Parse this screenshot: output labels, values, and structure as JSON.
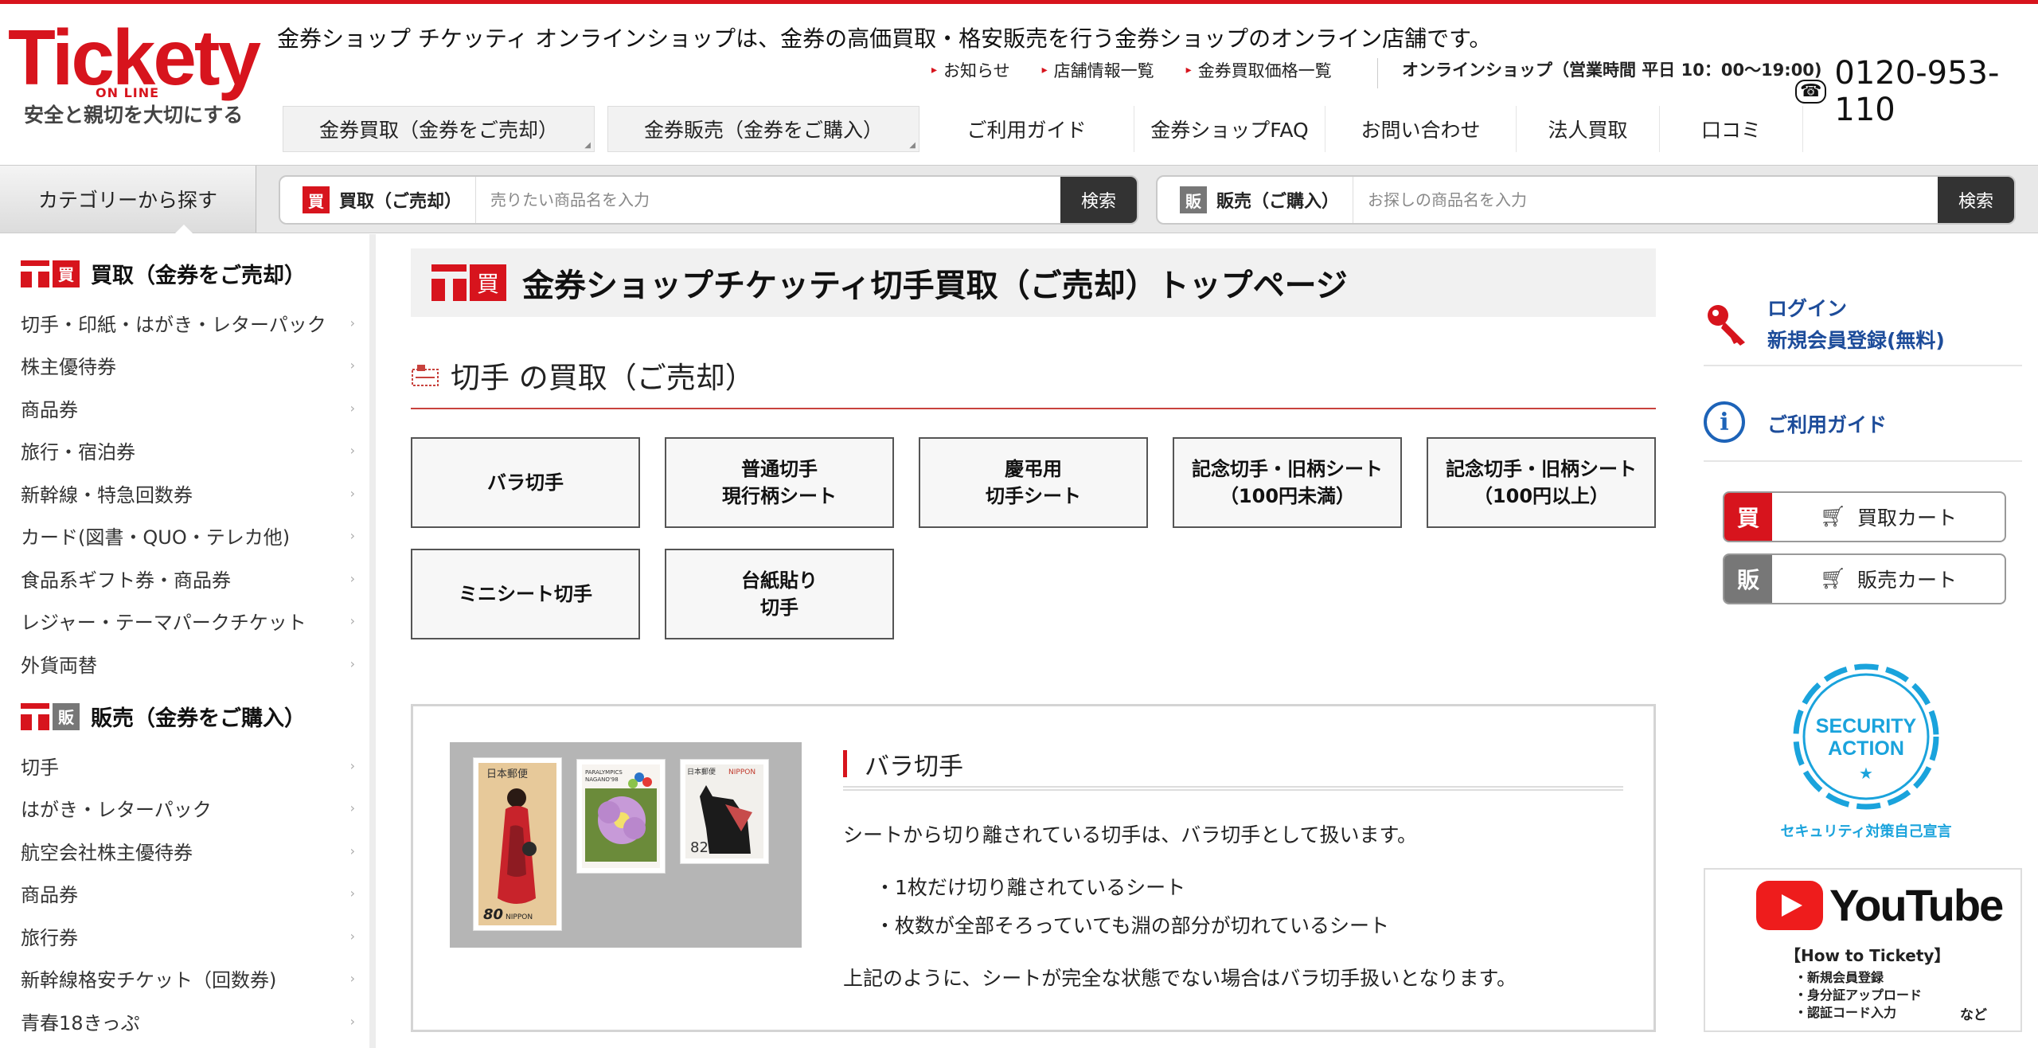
{
  "header": {
    "logo_text": "Tickety",
    "logo_sub": "ON LINE",
    "logo_tagline": "安全と親切を大切にする",
    "tagline": "金券ショップ チケッティ オンラインショップは、金券の高価買取・格安販売を行う金券ショップのオンライン店舗です。",
    "top_links": [
      "お知らせ",
      "店舗情報一覧",
      "金券買取価格一覧"
    ],
    "hours": "オンラインショップ（営業時間 平日 10：00〜19:00)",
    "phone_icon": "free-dial-icon",
    "phone": "0120-953-110",
    "nav_buttons": [
      "金券買取（金券をご売却）",
      "金券販売（金券をご購入）"
    ],
    "nav_links": [
      "ご利用ガイド",
      "金券ショップFAQ",
      "お問い合わせ",
      "法人買取",
      "口コミ"
    ]
  },
  "search": {
    "category_button": "カテゴリーから探す",
    "buy_badge": "買",
    "buy_label": "買取（ご売却）",
    "buy_placeholder": "売りたい商品名を入力",
    "buy_button": "検索",
    "sell_badge": "販",
    "sell_label": "販売（ご購入）",
    "sell_placeholder": "お探しの商品名を入力",
    "sell_button": "検索"
  },
  "sidebar": {
    "buy_head_badge": "買",
    "buy_head": "買取（金券をご売却）",
    "buy_items": [
      "切手・印紙・はがき・レターパック",
      "株主優待券",
      "商品券",
      "旅行・宿泊券",
      "新幹線・特急回数券",
      "カード(図書・QUO・テレカ他)",
      "食品系ギフト券・商品券",
      "レジャー・テーマパークチケット",
      "外貨両替"
    ],
    "sell_head_badge": "販",
    "sell_head": "販売（金券をご購入）",
    "sell_items": [
      "切手",
      "はがき・レターパック",
      "航空会社株主優待券",
      "商品券",
      "旅行券",
      "新幹線格安チケット（回数券)",
      "青春18きっぷ"
    ]
  },
  "main": {
    "title_badge": "買",
    "page_title": "金券ショップチケッティ切手買取（ご売却）トップページ",
    "section_title": "切手 の買取（ご売却）",
    "categories": [
      {
        "line1": "バラ切手",
        "line2": ""
      },
      {
        "line1": "普通切手",
        "line2": "現行柄シート"
      },
      {
        "line1": "慶弔用",
        "line2": "切手シート"
      },
      {
        "line1": "記念切手・旧柄シート",
        "line2": "（100円未満）"
      },
      {
        "line1": "記念切手・旧柄シート",
        "line2": "（100円以上）"
      },
      {
        "line1": "ミニシート切手",
        "line2": ""
      },
      {
        "line1": "台紙貼り",
        "line2": "切手"
      }
    ],
    "feature": {
      "title": "バラ切手",
      "p1": "シートから切り離されている切手は、バラ切手として扱います。",
      "bullets": [
        "・1枚だけ切り離されているシート",
        "・枚数が全部そろっていても淵の部分が切れているシート"
      ],
      "p2": "上記のように、シートが完全な状態でない場合はバラ切手扱いとなります。",
      "stamp1_top": "日本郵便",
      "stamp1_value": "80",
      "stamp1_bottom": "NIPPON",
      "stamp2_top": "PARALYMPICS NAGANO'98",
      "stamp3_top": "日本郵便",
      "stamp3_top2": "NIPPON",
      "stamp3_value": "82"
    }
  },
  "right": {
    "login": "ログイン",
    "register": "新規会員登録(無料)",
    "guide": "ご利用ガイド",
    "buy_cart_badge": "買",
    "buy_cart": "買取カート",
    "sell_cart_badge": "販",
    "sell_cart": "販売カート",
    "security_line1": "SECURITY",
    "security_line2": "ACTION",
    "security_label": "セキュリティ対策自己宣言",
    "youtube_logo": "YouTube",
    "youtube_how": "【How to Tickety】",
    "youtube_items": [
      "・新規会員登録",
      "・身分証アップロード",
      "・認証コード入力"
    ],
    "youtube_etc": "など"
  },
  "colors": {
    "brand_red": "#d7141d",
    "link_blue": "#1d4c9a",
    "sell_gray": "#777777",
    "security_blue": "#1aa3dc"
  }
}
